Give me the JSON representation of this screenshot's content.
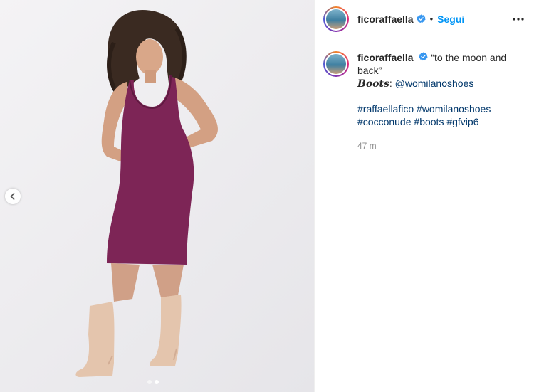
{
  "post": {
    "username": "ficoraffaella",
    "follow_label": "Segui",
    "separator": "•"
  },
  "caption": {
    "username": "ficoraffaella",
    "quote": "“to the moon and back”",
    "boots_word": "Boots",
    "boots_colon": ": ",
    "mention": "@womilanoshoes",
    "hashtags": [
      "#raffaellafico",
      "#womilanoshoes",
      "#cocconude",
      "#boots",
      "#gfvip6"
    ],
    "time": "47 m"
  },
  "media": {
    "carousel_total": 2,
    "carousel_active": 2
  },
  "icons": {
    "verified": "verified-badge-icon",
    "more": "more-options-icon",
    "prev": "chevron-left-icon"
  },
  "colors": {
    "follow": "#0095f6",
    "link": "#00376b",
    "dress": "#7d2556",
    "boots": "#e4c5ad",
    "verified": "#3897f0"
  }
}
